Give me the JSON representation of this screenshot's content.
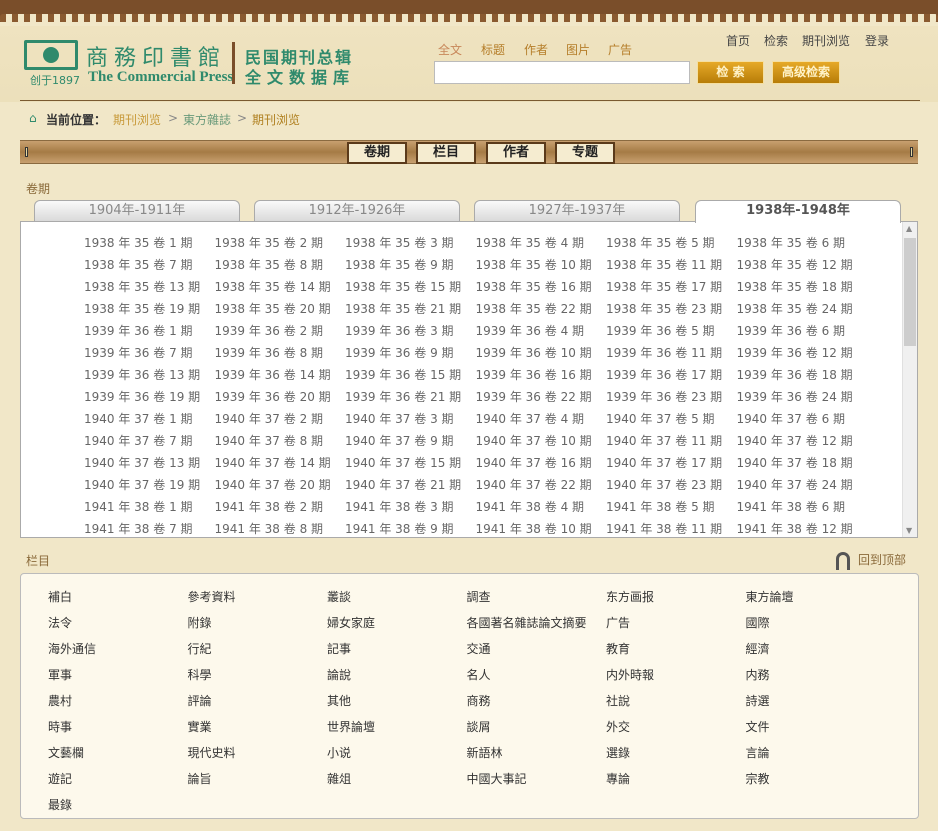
{
  "brand": {
    "since": "创于1897",
    "cn_name": "商務印書館",
    "en_name": "The Commercial Press",
    "db_line1": "民国期刊总辑",
    "db_line2": "全文数据库"
  },
  "search": {
    "types": [
      "全文",
      "标题",
      "作者",
      "图片",
      "广告"
    ],
    "active_type": "全文",
    "value": "",
    "search_label": "检 索",
    "advanced_label": "高级检索"
  },
  "top_nav": [
    "首页",
    "检索",
    "期刊浏览",
    "登录"
  ],
  "breadcrumb": {
    "label": "当前位置：",
    "items": [
      "期刊浏览",
      "東方雜誌",
      "期刊浏览"
    ],
    "sep": ">"
  },
  "browse_tabs": [
    "卷期",
    "栏目",
    "作者",
    "专题"
  ],
  "volumes": {
    "title": "卷期",
    "period_tabs": [
      "1904年-1911年",
      "1912年-1926年",
      "1927年-1937年",
      "1938年-1948年"
    ],
    "active_period": "1938年-1948年",
    "issues": [
      "1938 年 35 卷 1 期",
      "1938 年 35 卷 2 期",
      "1938 年 35 卷 3 期",
      "1938 年 35 卷 4 期",
      "1938 年 35 卷 5 期",
      "1938 年 35 卷 6 期",
      "1938 年 35 卷 7 期",
      "1938 年 35 卷 8 期",
      "1938 年 35 卷 9 期",
      "1938 年 35 卷 10 期",
      "1938 年 35 卷 11 期",
      "1938 年 35 卷 12 期",
      "1938 年 35 卷 13 期",
      "1938 年 35 卷 14 期",
      "1938 年 35 卷 15 期",
      "1938 年 35 卷 16 期",
      "1938 年 35 卷 17 期",
      "1938 年 35 卷 18 期",
      "1938 年 35 卷 19 期",
      "1938 年 35 卷 20 期",
      "1938 年 35 卷 21 期",
      "1938 年 35 卷 22 期",
      "1938 年 35 卷 23 期",
      "1938 年 35 卷 24 期",
      "1939 年 36 卷 1 期",
      "1939 年 36 卷 2 期",
      "1939 年 36 卷 3 期",
      "1939 年 36 卷 4 期",
      "1939 年 36 卷 5 期",
      "1939 年 36 卷 6 期",
      "1939 年 36 卷 7 期",
      "1939 年 36 卷 8 期",
      "1939 年 36 卷 9 期",
      "1939 年 36 卷 10 期",
      "1939 年 36 卷 11 期",
      "1939 年 36 卷 12 期",
      "1939 年 36 卷 13 期",
      "1939 年 36 卷 14 期",
      "1939 年 36 卷 15 期",
      "1939 年 36 卷 16 期",
      "1939 年 36 卷 17 期",
      "1939 年 36 卷 18 期",
      "1939 年 36 卷 19 期",
      "1939 年 36 卷 20 期",
      "1939 年 36 卷 21 期",
      "1939 年 36 卷 22 期",
      "1939 年 36 卷 23 期",
      "1939 年 36 卷 24 期",
      "1940 年 37 卷 1 期",
      "1940 年 37 卷 2 期",
      "1940 年 37 卷 3 期",
      "1940 年 37 卷 4 期",
      "1940 年 37 卷 5 期",
      "1940 年 37 卷 6 期",
      "1940 年 37 卷 7 期",
      "1940 年 37 卷 8 期",
      "1940 年 37 卷 9 期",
      "1940 年 37 卷 10 期",
      "1940 年 37 卷 11 期",
      "1940 年 37 卷 12 期",
      "1940 年 37 卷 13 期",
      "1940 年 37 卷 14 期",
      "1940 年 37 卷 15 期",
      "1940 年 37 卷 16 期",
      "1940 年 37 卷 17 期",
      "1940 年 37 卷 18 期",
      "1940 年 37 卷 19 期",
      "1940 年 37 卷 20 期",
      "1940 年 37 卷 21 期",
      "1940 年 37 卷 22 期",
      "1940 年 37 卷 23 期",
      "1940 年 37 卷 24 期",
      "1941 年 38 卷 1 期",
      "1941 年 38 卷 2 期",
      "1941 年 38 卷 3 期",
      "1941 年 38 卷 4 期",
      "1941 年 38 卷 5 期",
      "1941 年 38 卷 6 期",
      "1941 年 38 卷 7 期",
      "1941 年 38 卷 8 期",
      "1941 年 38 卷 9 期",
      "1941 年 38 卷 10 期",
      "1941 年 38 卷 11 期",
      "1941 年 38 卷 12 期"
    ]
  },
  "columns": {
    "title": "栏目",
    "back_to_top": "回到顶部",
    "items": [
      "補白",
      "參考資料",
      "叢談",
      "調查",
      "东方画报",
      "東方論壇",
      "法令",
      "附錄",
      "婦女家庭",
      "各國著名雜誌論文摘要",
      "广告",
      "國際",
      "海外通信",
      "行紀",
      "記事",
      "交通",
      "教育",
      "經濟",
      "軍事",
      "科學",
      "論說",
      "名人",
      "内外時報",
      "内務",
      "農村",
      "評論",
      "其他",
      "商務",
      "社說",
      "詩選",
      "時事",
      "實業",
      "世界論壇",
      "談屑",
      "外交",
      "文件",
      "文藝欄",
      "現代史料",
      "小说",
      "新語林",
      "選錄",
      "言論",
      "遊記",
      "論旨",
      "雜俎",
      "中國大事記",
      "專論",
      "宗教",
      "最錄"
    ]
  },
  "colors": {
    "brand_green": "#2f8a6c",
    "accent_gold": "#b77d08",
    "background": "#f1e7c8",
    "frame_brown": "#7a4e2a"
  }
}
